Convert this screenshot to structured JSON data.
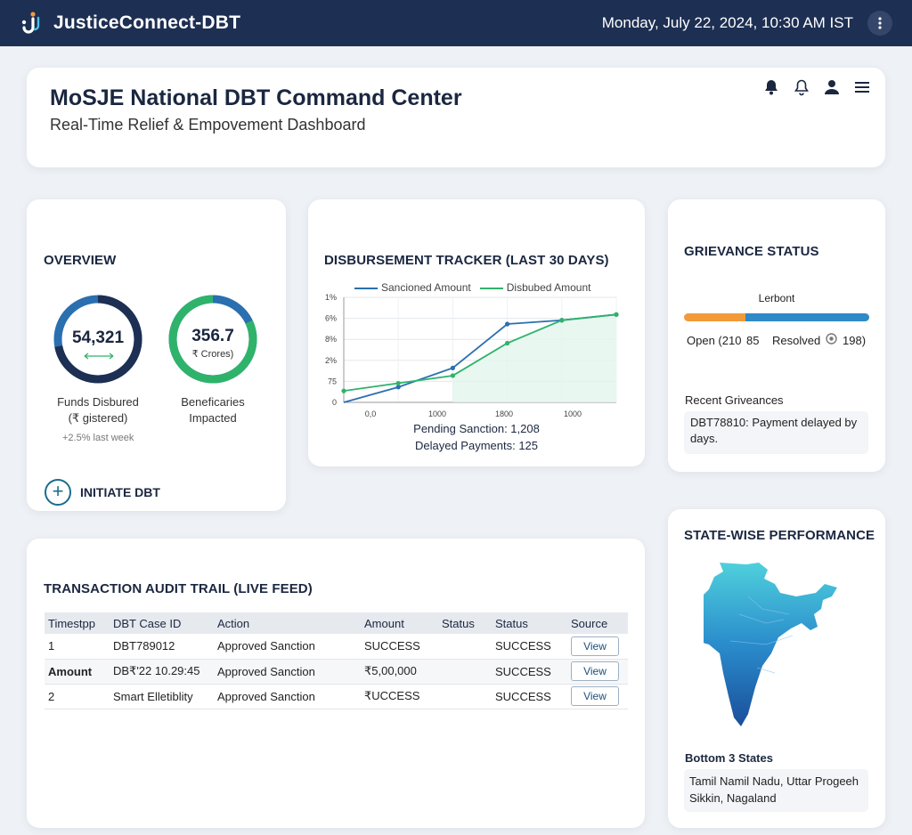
{
  "header": {
    "app_title": "JusticeConnect-DBT",
    "datetime": "Monday, July 22, 2024, 10:30 AM IST"
  },
  "dashboard": {
    "title": "MoSJE National DBT Command Center",
    "subtitle": "Real-Time Relief & Empovement Dashboard"
  },
  "overview": {
    "title": "OVERVIEW",
    "funds": {
      "value": "54,321",
      "label_line1": "Funds Disbured",
      "label_line2": "(₹ gistered)",
      "trend": "+2.5% last week",
      "fill_fraction": 0.72
    },
    "beneficiaries": {
      "value": "356.7",
      "unit": "₹ Crores)",
      "label_line1": "Beneficaries",
      "label_line2": "Impacted",
      "fill_fraction": 0.82
    },
    "initiate_label": "INITIATE DBT"
  },
  "tracker": {
    "title": "DISBURSEMENT TRACKER (LAST 30 DAYS)",
    "pending": "Pending Sanction: 1,208",
    "delayed": "Delayed Payments: 125"
  },
  "chart_data": {
    "type": "line",
    "title": "DISBURSEMENT TRACKER (LAST 30 DAYS)",
    "x_tick_labels": [
      "0,0",
      "1000",
      "1800",
      "1000"
    ],
    "y_tick_labels": [
      "0",
      "75",
      "2%",
      "8%",
      "6%",
      "1%"
    ],
    "series": [
      {
        "name": "Sancioned Amount",
        "color": "#2a6fb0",
        "values": [
          0,
          0.8,
          1.8,
          4.1,
          4.3,
          4.6
        ]
      },
      {
        "name": "Disbubed Amount",
        "color": "#2fb36b",
        "values": [
          0.6,
          1.0,
          1.4,
          3.1,
          4.3,
          4.6
        ]
      }
    ],
    "ylim": [
      0,
      5.5
    ],
    "grid": true,
    "legend": "top"
  },
  "grievance": {
    "title": "GRIEVANCE STATUS",
    "bar_label": "Lerbont",
    "open_text": "Open (210",
    "open_extra": "85",
    "resolved_text": "Resolved",
    "resolved_value": "198)",
    "open_fraction": 0.33,
    "recent_title": "Recent Griveances",
    "recent_item": "DBT78810: Payment delayed by days."
  },
  "audit": {
    "title": "TRANSACTION AUDIT TRAIL (LIVE FEED)",
    "columns": [
      "Timestpp",
      "DBT Case ID",
      "Action",
      "Amount",
      "Status",
      "Status",
      "Source"
    ],
    "rows": [
      {
        "c0": "1",
        "c1": "DBT789012",
        "c2": "Approved Sanction",
        "c3": "SUCCESS",
        "c4": "",
        "c5": "SUCCESS",
        "btn": "View"
      },
      {
        "c0": "Amount",
        "c1": "DB₹'22 10.29:45",
        "c2": "Approved Sanction",
        "c3": "₹5,00,000",
        "c4": "",
        "c5": "SUCCESS",
        "btn": "View"
      },
      {
        "c0": "2",
        "c1": "Smart Elletiblity",
        "c2": "Approved Sanction",
        "c3": "₹UCCESS",
        "c4": "",
        "c5": "SUCCESS",
        "btn": "View"
      }
    ]
  },
  "state": {
    "title": "STATE-WISE PERFORMANCE",
    "bottom_title": "Bottom 3 States",
    "bottom_states": "Tamil Namil Nadu, Uttar Progeeh Sikkin, Nagaland"
  },
  "colors": {
    "topbar": "#1d2f52",
    "accent_blue": "#2a6fb0",
    "accent_green": "#2fb36b",
    "open_orange": "#f29a3a",
    "resolved_blue": "#2f8ac6"
  },
  "icons": [
    "logo-icon",
    "more-vertical-icon",
    "bell-filled-icon",
    "bell-outline-icon",
    "user-icon",
    "menu-icon",
    "plus-circle-icon",
    "india-map"
  ]
}
